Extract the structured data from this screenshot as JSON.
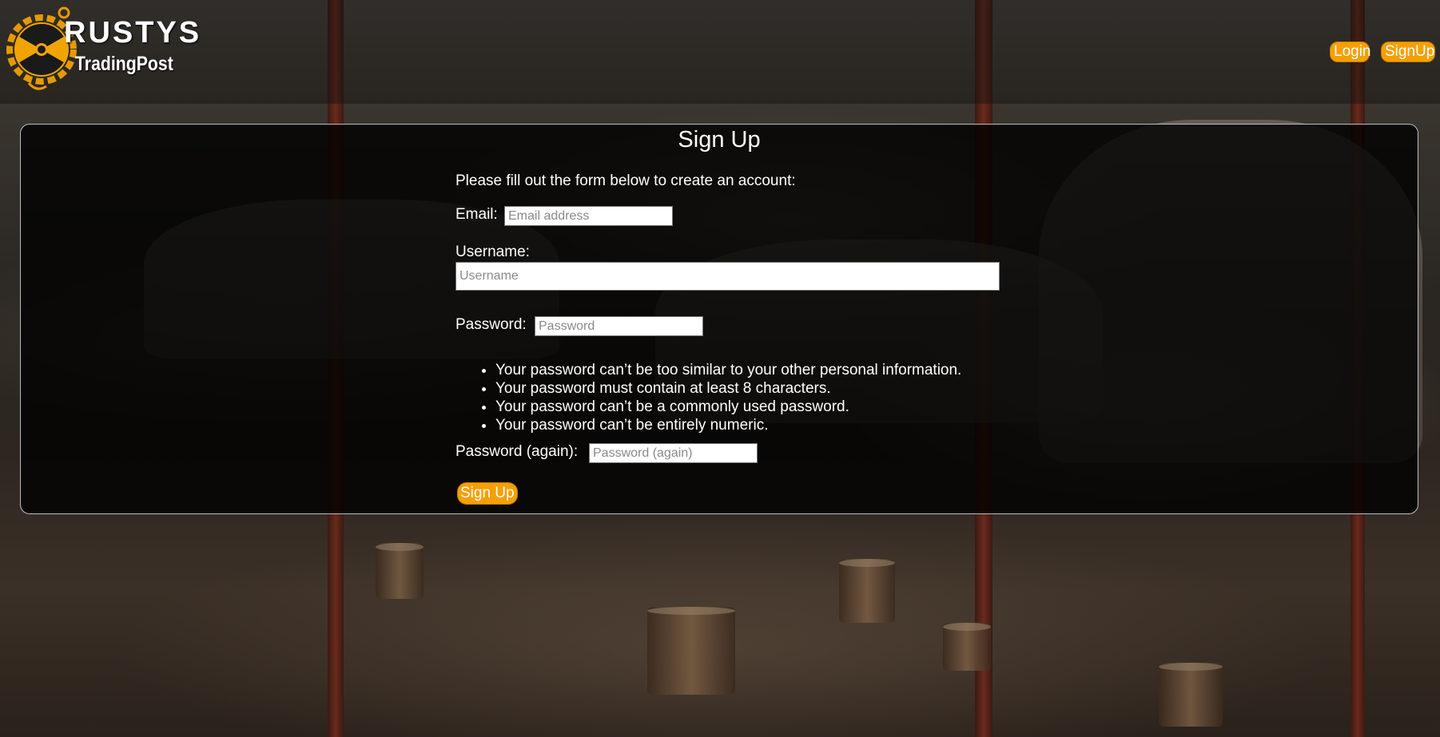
{
  "brand": {
    "name_line1": "RUSTYS",
    "name_line2": "TradingPost",
    "logo_icon": "radiation-gear-icon",
    "accent_color": "#f5a000"
  },
  "nav": {
    "login_label": "Login",
    "signup_label": "SignUp"
  },
  "form": {
    "title": "Sign Up",
    "intro": "Please fill out the form below to create an account:",
    "email": {
      "label": "Email:",
      "placeholder": "Email address",
      "value": ""
    },
    "username": {
      "label": "Username:",
      "placeholder": "Username",
      "value": ""
    },
    "password": {
      "label": "Password:",
      "placeholder": "Password",
      "value": ""
    },
    "password_rules": [
      "Your password can’t be too similar to your other personal information.",
      "Your password must contain at least 8 characters.",
      "Your password can’t be a commonly used password.",
      "Your password can’t be entirely numeric."
    ],
    "password_again": {
      "label": "Password (again):",
      "placeholder": "Password (again)",
      "value": ""
    },
    "submit_label": "Sign Up"
  }
}
